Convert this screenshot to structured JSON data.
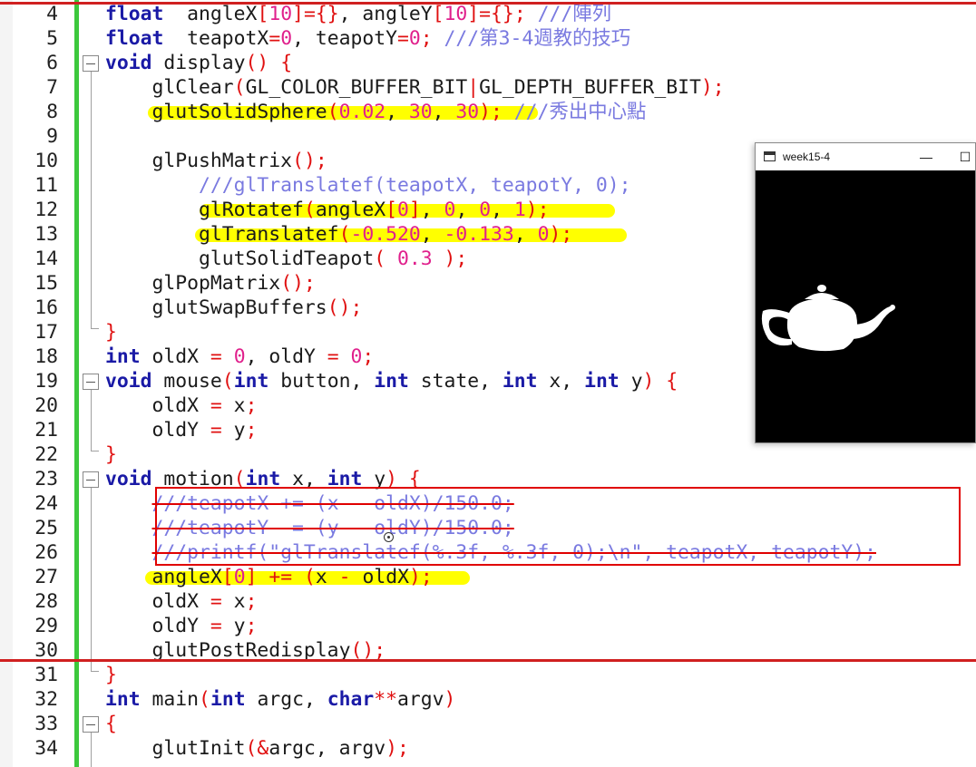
{
  "editor": {
    "lines": [
      {
        "n": "4",
        "segs": [
          [
            "kw",
            "float"
          ],
          [
            "",
            "  angleX"
          ],
          [
            "op",
            "["
          ],
          [
            "num",
            "10"
          ],
          [
            "op",
            "]={}"
          ],
          [
            "",
            ", angleY"
          ],
          [
            "op",
            "["
          ],
          [
            "num",
            "10"
          ],
          [
            "op",
            "]={}"
          ],
          [
            "op",
            ";"
          ],
          [
            "cm",
            " ///"
          ],
          [
            "cm cjk",
            "陣列"
          ]
        ]
      },
      {
        "n": "5",
        "segs": [
          [
            "kw",
            "float"
          ],
          [
            "",
            "  teapotX"
          ],
          [
            "op",
            "="
          ],
          [
            "num",
            "0"
          ],
          [
            "",
            ", teapotY"
          ],
          [
            "op",
            "="
          ],
          [
            "num",
            "0"
          ],
          [
            "op",
            ";"
          ],
          [
            "cm",
            " ///"
          ],
          [
            "cm cjk",
            "第"
          ],
          [
            "cm",
            "3-4"
          ],
          [
            "cm cjk",
            "週教的技巧"
          ]
        ]
      },
      {
        "n": "6",
        "segs": [
          [
            "kw",
            "void"
          ],
          [
            "",
            " display"
          ],
          [
            "op",
            "()"
          ],
          [
            "",
            " "
          ],
          [
            "op",
            "{"
          ]
        ]
      },
      {
        "n": "7",
        "segs": [
          [
            "",
            "    glClear"
          ],
          [
            "op",
            "("
          ],
          [
            "",
            "GL_COLOR_BUFFER_BIT"
          ],
          [
            "op",
            "|"
          ],
          [
            "",
            "GL_DEPTH_BUFFER_BIT"
          ],
          [
            "op",
            ");"
          ]
        ]
      },
      {
        "n": "8",
        "segs": [
          [
            "",
            "    glutSolidSphere"
          ],
          [
            "op",
            "("
          ],
          [
            "num",
            "0.02"
          ],
          [
            "",
            ", "
          ],
          [
            "num",
            "30"
          ],
          [
            "",
            ", "
          ],
          [
            "num",
            "30"
          ],
          [
            "op",
            ");"
          ],
          [
            "cm",
            " ///"
          ],
          [
            "cm cjk",
            "秀出中心點"
          ]
        ]
      },
      {
        "n": "9",
        "segs": []
      },
      {
        "n": "10",
        "segs": [
          [
            "",
            "    glPushMatrix"
          ],
          [
            "op",
            "();"
          ]
        ]
      },
      {
        "n": "11",
        "segs": [
          [
            "cm",
            "        ///glTranslatef(teapotX, teapotY, 0);"
          ]
        ]
      },
      {
        "n": "12",
        "segs": [
          [
            "",
            "        glRotatef"
          ],
          [
            "op",
            "("
          ],
          [
            "",
            "angleX"
          ],
          [
            "op",
            "["
          ],
          [
            "num",
            "0"
          ],
          [
            "op",
            "]"
          ],
          [
            "",
            ", "
          ],
          [
            "num",
            "0"
          ],
          [
            "",
            ", "
          ],
          [
            "num",
            "0"
          ],
          [
            "",
            ", "
          ],
          [
            "num",
            "1"
          ],
          [
            "op",
            ");"
          ]
        ]
      },
      {
        "n": "13",
        "segs": [
          [
            "",
            "        glTranslatef"
          ],
          [
            "op",
            "("
          ],
          [
            "num",
            "-0.520"
          ],
          [
            "",
            ", "
          ],
          [
            "num",
            "-0.133"
          ],
          [
            "",
            ", "
          ],
          [
            "num",
            "0"
          ],
          [
            "op",
            ");"
          ]
        ]
      },
      {
        "n": "14",
        "segs": [
          [
            "",
            "        glutSolidTeapot"
          ],
          [
            "op",
            "("
          ],
          [
            "num",
            " 0.3 "
          ],
          [
            "op",
            ");"
          ]
        ]
      },
      {
        "n": "15",
        "segs": [
          [
            "",
            "    glPopMatrix"
          ],
          [
            "op",
            "();"
          ]
        ]
      },
      {
        "n": "16",
        "segs": [
          [
            "",
            "    glutSwapBuffers"
          ],
          [
            "op",
            "();"
          ]
        ]
      },
      {
        "n": "17",
        "segs": [
          [
            "op",
            "}"
          ]
        ]
      },
      {
        "n": "18",
        "segs": [
          [
            "kw",
            "int"
          ],
          [
            "",
            " oldX "
          ],
          [
            "op",
            "="
          ],
          [
            "",
            " "
          ],
          [
            "num",
            "0"
          ],
          [
            "",
            ", oldY "
          ],
          [
            "op",
            "="
          ],
          [
            "",
            " "
          ],
          [
            "num",
            "0"
          ],
          [
            "op",
            ";"
          ]
        ]
      },
      {
        "n": "19",
        "segs": [
          [
            "kw",
            "void"
          ],
          [
            "",
            " mouse"
          ],
          [
            "op",
            "("
          ],
          [
            "kw",
            "int"
          ],
          [
            "",
            " button, "
          ],
          [
            "kw",
            "int"
          ],
          [
            "",
            " state, "
          ],
          [
            "kw",
            "int"
          ],
          [
            "",
            " x, "
          ],
          [
            "kw",
            "int"
          ],
          [
            "",
            " y"
          ],
          [
            "op",
            ")"
          ],
          [
            "",
            " "
          ],
          [
            "op",
            "{"
          ]
        ]
      },
      {
        "n": "20",
        "segs": [
          [
            "",
            "    oldX "
          ],
          [
            "op",
            "="
          ],
          [
            "",
            " x"
          ],
          [
            "op",
            ";"
          ]
        ]
      },
      {
        "n": "21",
        "segs": [
          [
            "",
            "    oldY "
          ],
          [
            "op",
            "="
          ],
          [
            "",
            " y"
          ],
          [
            "op",
            ";"
          ]
        ]
      },
      {
        "n": "22",
        "segs": [
          [
            "op",
            "}"
          ]
        ]
      },
      {
        "n": "23",
        "segs": [
          [
            "kw",
            "void"
          ],
          [
            "",
            " motion"
          ],
          [
            "op",
            "("
          ],
          [
            "kw",
            "int"
          ],
          [
            "",
            " x, "
          ],
          [
            "kw",
            "int"
          ],
          [
            "",
            " y"
          ],
          [
            "op",
            ")"
          ],
          [
            "",
            " "
          ],
          [
            "op",
            "{"
          ]
        ]
      },
      {
        "n": "24",
        "segs": [
          [
            "",
            "    "
          ],
          [
            "cm strike",
            "///teapotX += (x - oldX)/150.0;"
          ]
        ]
      },
      {
        "n": "25",
        "segs": [
          [
            "",
            "    "
          ],
          [
            "cm strike",
            "///teapotY -= (y - oldY)/150.0;"
          ]
        ]
      },
      {
        "n": "26",
        "segs": [
          [
            "",
            "    "
          ],
          [
            "cm strike",
            "///printf(\"glTranslatef(%.3f, %.3f, 0);\\n\", teapotX, teapotY);"
          ]
        ]
      },
      {
        "n": "27",
        "segs": [
          [
            "",
            "    angleX"
          ],
          [
            "op",
            "["
          ],
          [
            "num",
            "0"
          ],
          [
            "op",
            "]"
          ],
          [
            "",
            " "
          ],
          [
            "op",
            "+="
          ],
          [
            "",
            " "
          ],
          [
            "op",
            "("
          ],
          [
            "",
            "x "
          ],
          [
            "op",
            "-"
          ],
          [
            "",
            " oldX"
          ],
          [
            "op",
            ");"
          ]
        ]
      },
      {
        "n": "28",
        "segs": [
          [
            "",
            "    oldX "
          ],
          [
            "op",
            "="
          ],
          [
            "",
            " x"
          ],
          [
            "op",
            ";"
          ]
        ]
      },
      {
        "n": "29",
        "segs": [
          [
            "",
            "    oldY "
          ],
          [
            "op",
            "="
          ],
          [
            "",
            " y"
          ],
          [
            "op",
            ";"
          ]
        ]
      },
      {
        "n": "30",
        "segs": [
          [
            "",
            "    glutPostRedisplay"
          ],
          [
            "op",
            "();"
          ]
        ]
      },
      {
        "n": "31",
        "segs": [
          [
            "op",
            "}"
          ]
        ]
      },
      {
        "n": "32",
        "segs": [
          [
            "kw",
            "int"
          ],
          [
            "",
            " main"
          ],
          [
            "op",
            "("
          ],
          [
            "kw",
            "int"
          ],
          [
            "",
            " argc, "
          ],
          [
            "kw",
            "char"
          ],
          [
            "op",
            "**"
          ],
          [
            "",
            "argv"
          ],
          [
            "op",
            ")"
          ]
        ]
      },
      {
        "n": "33",
        "segs": [
          [
            "op",
            "{"
          ]
        ]
      },
      {
        "n": "34",
        "segs": [
          [
            "",
            "    glutInit"
          ],
          [
            "op",
            "(&"
          ],
          [
            "",
            "argc, argv"
          ],
          [
            "op",
            ");"
          ]
        ]
      }
    ]
  },
  "glwindow": {
    "title": "week15-4",
    "minimize": "—",
    "maximize": "☐",
    "icon": "window-app-icon",
    "background": "#000000",
    "object_color": "#ffffff"
  },
  "colors": {
    "keyword": "#1a1aa6",
    "number": "#e0208c",
    "operator": "#e01010",
    "comment": "#7a7ae0",
    "highlight": "#ffff00",
    "annotation": "#e00000",
    "changebar": "#3cc83c"
  }
}
